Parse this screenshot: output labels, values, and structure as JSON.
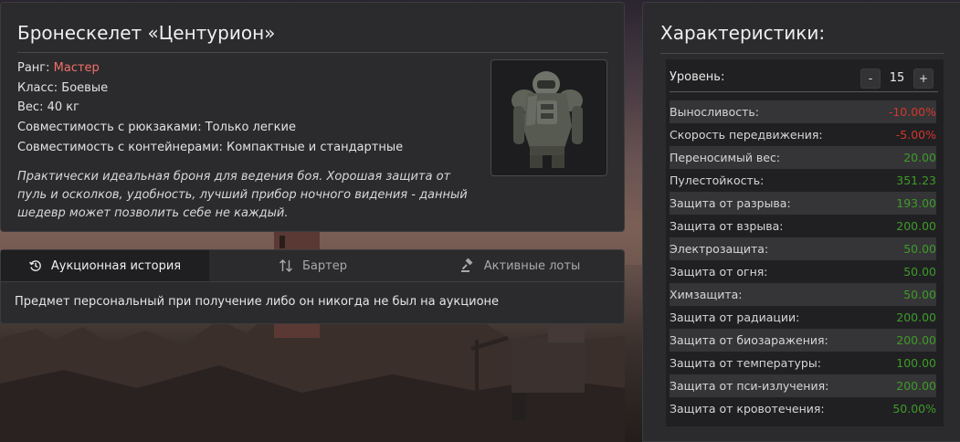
{
  "item": {
    "title": "Бронескелет «Центурион»",
    "rank_label": "Ранг: ",
    "rank_value": "Мастер",
    "class": "Класс: Боевые",
    "weight": "Вес: 40 кг",
    "backpack_compat": "Совместимость с рюкзаками: Только легкие",
    "container_compat": "Совместимость с контейнерами: Компактные и стандартные",
    "description": "Практически идеальная броня для ведения боя. Хорошая защита от пуль и осколков, удобность, лучший прибор ночного видения - данный шедевр может позволить себе не каждый.",
    "image_icon": "armor-exoskeleton-image"
  },
  "tabs": {
    "items": [
      {
        "label": "Аукционная история",
        "icon": "history-icon",
        "active": true
      },
      {
        "label": "Бартер",
        "icon": "swap-arrows-icon",
        "active": false
      },
      {
        "label": "Активные лоты",
        "icon": "gavel-icon",
        "active": false
      }
    ],
    "message": "Предмет персональный при получение либо он никогда не был на аукционе"
  },
  "stats": {
    "heading": "Характеристики:",
    "level_label": "Уровень:",
    "level_value": "15",
    "minus_label": "-",
    "plus_label": "+",
    "rows": [
      {
        "label": "Выносливость:",
        "value": "-10.00%",
        "sign": "negative"
      },
      {
        "label": "Скорость передвижения:",
        "value": "-5.00%",
        "sign": "negative"
      },
      {
        "label": "Переносимый вес:",
        "value": "20.00",
        "sign": "positive"
      },
      {
        "label": "Пулестойкость:",
        "value": "351.23",
        "sign": "positive"
      },
      {
        "label": "Защита от разрыва:",
        "value": "193.00",
        "sign": "positive"
      },
      {
        "label": "Защита от взрыва:",
        "value": "200.00",
        "sign": "positive"
      },
      {
        "label": "Электрозащита:",
        "value": "50.00",
        "sign": "positive"
      },
      {
        "label": "Защита от огня:",
        "value": "50.00",
        "sign": "positive"
      },
      {
        "label": "Химзащита:",
        "value": "50.00",
        "sign": "positive"
      },
      {
        "label": "Защита от радиации:",
        "value": "200.00",
        "sign": "positive"
      },
      {
        "label": "Защита от биозаражения:",
        "value": "200.00",
        "sign": "positive"
      },
      {
        "label": "Защита от температуры:",
        "value": "100.00",
        "sign": "positive"
      },
      {
        "label": "Защита от пси-излучения:",
        "value": "200.00",
        "sign": "positive"
      },
      {
        "label": "Защита от кровотечения:",
        "value": "50.00%",
        "sign": "positive"
      }
    ],
    "colors": {
      "negative": "#d0382e",
      "positive": "#3f9a2a"
    }
  }
}
